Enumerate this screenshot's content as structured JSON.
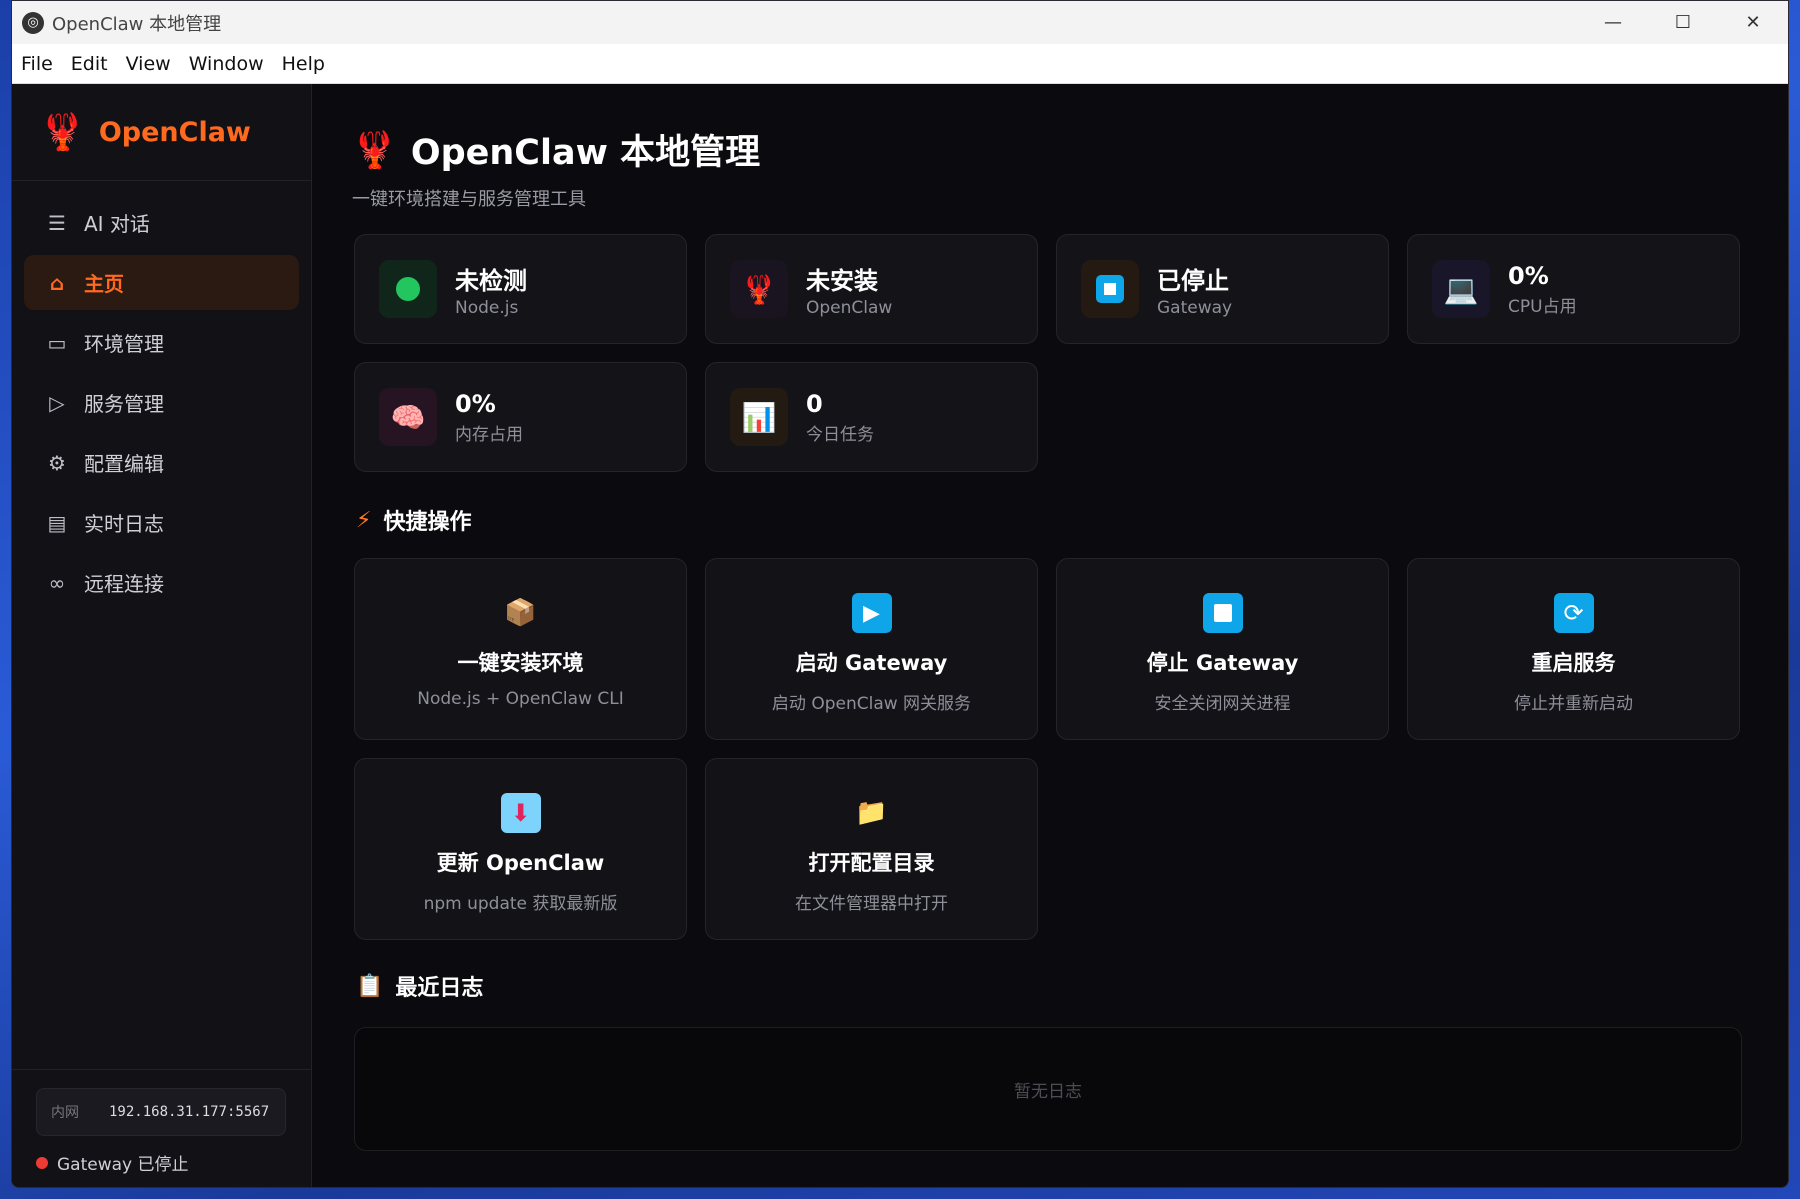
{
  "window": {
    "title": "OpenClaw 本地管理",
    "controls": {
      "minimize": "—",
      "maximize": "☐",
      "close": "✕"
    }
  },
  "menubar": [
    "File",
    "Edit",
    "View",
    "Window",
    "Help"
  ],
  "sidebar": {
    "brand": "OpenClaw",
    "items": [
      {
        "label": "AI 对话",
        "icon": "chat-icon"
      },
      {
        "label": "主页",
        "icon": "home-icon"
      },
      {
        "label": "环境管理",
        "icon": "monitor-icon"
      },
      {
        "label": "服务管理",
        "icon": "play-circle-icon"
      },
      {
        "label": "配置编辑",
        "icon": "gear-icon"
      },
      {
        "label": "实时日志",
        "icon": "document-icon"
      },
      {
        "label": "远程连接",
        "icon": "link-icon"
      }
    ],
    "active_index": 1,
    "address": {
      "label": "内网",
      "value": "192.168.31.177:5567"
    },
    "gateway_status": "Gateway 已停止"
  },
  "header": {
    "title": "OpenClaw 本地管理",
    "subtitle": "一键环境搭建与服务管理工具"
  },
  "stats": [
    {
      "value": "未检测",
      "label": "Node.js",
      "icon": "green-dot-icon",
      "bg": "#11261a"
    },
    {
      "value": "未安装",
      "label": "OpenClaw",
      "icon": "lobster-icon",
      "bg": "#1a1420"
    },
    {
      "value": "已停止",
      "label": "Gateway",
      "icon": "stop-icon",
      "bg": "#251a12"
    },
    {
      "value": "0%",
      "label": "CPU占用",
      "icon": "laptop-icon",
      "bg": "#181628"
    },
    {
      "value": "0%",
      "label": "内存占用",
      "icon": "brain-icon",
      "bg": "#261423"
    },
    {
      "value": "0",
      "label": "今日任务",
      "icon": "chart-icon",
      "bg": "#231a12"
    }
  ],
  "quick_actions": {
    "title": "快捷操作",
    "items": [
      {
        "name": "一键安装环境",
        "desc": "Node.js + OpenClaw CLI",
        "icon": "package-icon"
      },
      {
        "name": "启动 Gateway",
        "desc": "启动 OpenClaw 网关服务",
        "icon": "play-icon"
      },
      {
        "name": "停止 Gateway",
        "desc": "安全关闭网关进程",
        "icon": "stop-icon"
      },
      {
        "name": "重启服务",
        "desc": "停止并重新启动",
        "icon": "refresh-icon"
      },
      {
        "name": "更新 OpenClaw",
        "desc": "npm update 获取最新版",
        "icon": "inbox-download-icon"
      },
      {
        "name": "打开配置目录",
        "desc": "在文件管理器中打开",
        "icon": "folder-icon"
      }
    ]
  },
  "logs": {
    "title": "最近日志",
    "empty_text": "暂无日志"
  },
  "colors": {
    "accent": "#ff6a1f",
    "status_stopped": "#ef3b36",
    "status_ok": "#22c55e"
  }
}
